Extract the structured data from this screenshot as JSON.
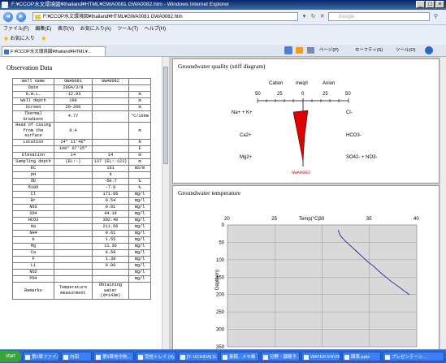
{
  "window": {
    "title": "F:¥CCOP水文環境図¥thailand¥HTML¥GWA0081 GWA0082.htm - Windows Internet Explorer",
    "min": "_",
    "max": "□",
    "close": "×"
  },
  "address": {
    "url": "F:¥CCOP水文環境図¥thailand¥HTML¥GWA0081 GWA0082.htm",
    "search_placeholder": "Google",
    "back": "◄",
    "forward": "►"
  },
  "menu": [
    "ファイル(F)",
    "編集(E)",
    "表示(V)",
    "お気に入り(A)",
    "ツール(T)",
    "ヘルプ(H)"
  ],
  "favorites": {
    "label": "お気に入り"
  },
  "tab": {
    "label": "F:¥CCOP水文環境図¥thailand¥HTML¥..."
  },
  "command_bar": {
    "page": "ページ(P)",
    "safety": "セーフティ(S)",
    "tools": "ツール(O)"
  },
  "observation": {
    "title": "Observation Data",
    "rows": [
      [
        "Well name",
        "GWA0081",
        "GWA0082",
        ""
      ],
      [
        "Date",
        "2004/3/8",
        "",
        ""
      ],
      [
        "G.W.L.",
        "-12.93",
        "",
        "m"
      ],
      [
        "Well depth",
        "199",
        "",
        "m"
      ],
      [
        "Screen",
        "20-200",
        "",
        "m"
      ],
      [
        "Thermal Gradient",
        "4.77",
        "",
        "°C/100m"
      ],
      [
        "Head of casing from the surface",
        "0.4",
        "",
        "m"
      ],
      [
        "Location",
        "14° 11'46\"",
        "",
        "N"
      ],
      [
        "",
        "100° 07'35\"",
        "",
        "E"
      ],
      [
        "Elevation",
        "14",
        "14",
        "m"
      ],
      [
        "Sampling depth",
        "(EL:-)",
        "137 (EL:-123)",
        "m"
      ],
      [
        "EC",
        "",
        "101",
        "mS/m"
      ],
      [
        "pH",
        "",
        "9",
        ""
      ],
      [
        "δD",
        "",
        "-50.7",
        "‰"
      ],
      [
        "δ18O",
        "",
        "-7.0",
        "‰"
      ],
      [
        "Cl",
        "",
        "171.86",
        "mg/l"
      ],
      [
        "Br",
        "",
        "0.54",
        "mg/l"
      ],
      [
        "NO3",
        "",
        "0.01",
        "mg/l"
      ],
      [
        "SO4",
        "",
        "44.19",
        "mg/l"
      ],
      [
        "HCO3",
        "",
        "302.40",
        "mg/l"
      ],
      [
        "Na",
        "",
        "211.56",
        "mg/l"
      ],
      [
        "NH4",
        "",
        "0.61",
        "mg/l"
      ],
      [
        "K",
        "",
        "1.55",
        "mg/l"
      ],
      [
        "Mg",
        "",
        "11.36",
        "mg/l"
      ],
      [
        "Ca",
        "",
        "8.69",
        "mg/l"
      ],
      [
        "F",
        "",
        "1.38",
        "mg/l"
      ],
      [
        "Li",
        "",
        "0.00",
        "mg/l"
      ],
      [
        "NO2",
        "",
        "",
        "mg/l"
      ],
      [
        "PO4",
        "",
        "",
        "mg/l"
      ],
      [
        "Remarks",
        "Temperature measurment",
        "Obtaining water (d=143m)",
        ""
      ]
    ]
  },
  "stiff": {
    "title": "Groundwater quality (stiff diagram)",
    "cation": "Cation",
    "unit": "meq/l",
    "anion": "Anion",
    "ticks": [
      "50",
      "25",
      "0",
      "25",
      "50"
    ],
    "left_labels": [
      "Na+ + K+",
      "Ca2+",
      "Mg2+"
    ],
    "right_labels": [
      "Cl-",
      "HCO3-",
      "SO42- + NO3-"
    ],
    "well_label": "GWA0082",
    "color": "#e00000"
  },
  "temp": {
    "title": "Groundwater temperature",
    "xlabel": "Temp(°C)",
    "ylabel": "Depth(m)"
  },
  "chart_data": {
    "type": "line",
    "title": "Groundwater temperature",
    "xlabel": "Temp(°C)",
    "ylabel": "Depth(m)",
    "xlim": [
      20,
      40
    ],
    "ylim": [
      0,
      350
    ],
    "x_ticks": [
      "20",
      "25",
      "30",
      "35",
      "40"
    ],
    "y_ticks": [
      "0",
      "50",
      "100",
      "150",
      "200",
      "250",
      "300",
      "350"
    ],
    "grid": true,
    "series": [
      {
        "x": [
          31.7,
          31.9,
          32.4,
          33.0,
          33.6,
          34.2,
          34.8,
          35.5,
          36.3,
          37.2,
          38.2,
          39.2
        ],
        "y": [
          15,
          30,
          45,
          60,
          75,
          90,
          105,
          120,
          140,
          160,
          180,
          200
        ]
      }
    ]
  },
  "taskbar": {
    "start": "start",
    "items": [
      "第2章ファイル",
      "内田",
      "第6章地中熱...",
      "受信トレイ (4)...",
      "[Y. UCHIDA] G...",
      "素稿 - メモ帳",
      "分野・戦略予...",
      "WATER ENVIR...",
      "図表.pptx",
      "プレゼンテーシ..."
    ]
  }
}
